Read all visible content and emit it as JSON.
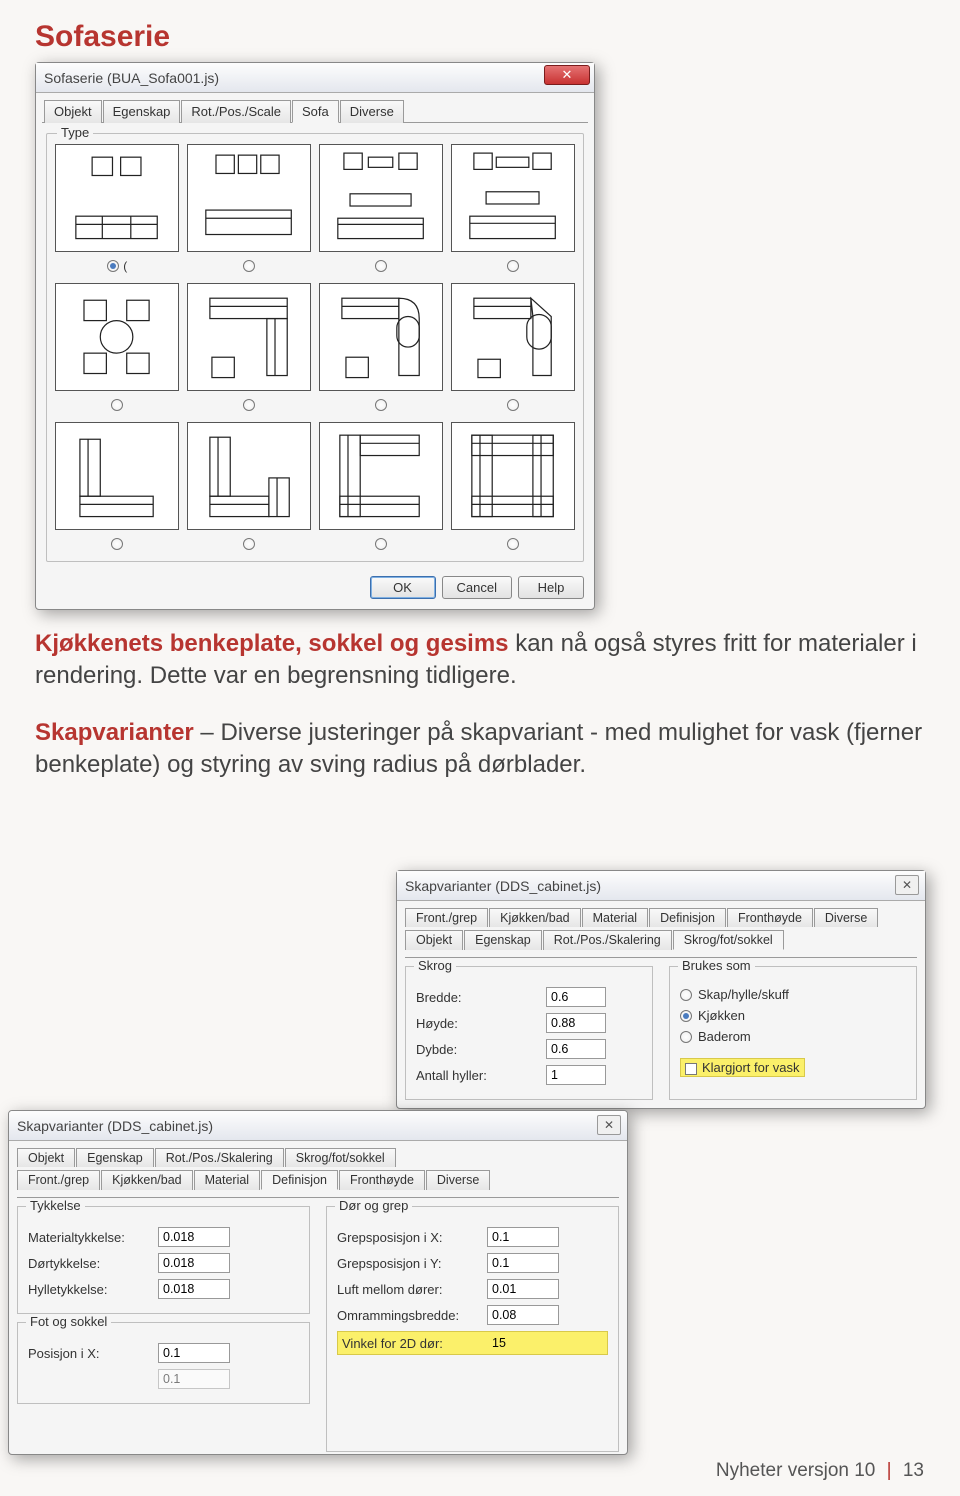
{
  "headings": {
    "sofaserie": "Sofaserie",
    "kjokken_prefix": "Kjøkkenets benkeplate, sokkel og gesims",
    "skapvar_prefix": "Skapvarianter"
  },
  "paragraphs": {
    "p1_rest": " kan nå også styres fritt for materialer i rendering. Dette var en begrensning tidligere.",
    "p2_rest": " – Diverse justeringer på skapvariant - med mulighet for vask (fjerner benkeplate) og styring av sving radius på dørblader."
  },
  "sofadialog": {
    "title": "Sofaserie (BUA_Sofa001.js)",
    "tabs": [
      "Objekt",
      "Egenskap",
      "Rot./Pos./Scale",
      "Sofa",
      "Diverse"
    ],
    "active_tab": "Sofa",
    "group": "Type",
    "selected_index": 0,
    "selected_suffix": "(",
    "buttons": {
      "ok": "OK",
      "cancel": "Cancel",
      "help": "Help"
    }
  },
  "skap1": {
    "title": "Skapvarianter (DDS_cabinet.js)",
    "tabs_top": [
      "Front./grep",
      "Kjøkken/bad",
      "Material",
      "Definisjon",
      "Fronthøyde",
      "Diverse"
    ],
    "tabs_bot": [
      "Objekt",
      "Egenskap",
      "Rot./Pos./Skalering",
      "Skrog/fot/sokkel"
    ],
    "active_tab": "Skrog/fot/sokkel",
    "grp_skrog": "Skrog",
    "grp_brukes": "Brukes som",
    "fields": {
      "bredde": {
        "label": "Bredde:",
        "value": "0.6"
      },
      "hoyde": {
        "label": "Høyde:",
        "value": "0.88"
      },
      "dybde": {
        "label": "Dybde:",
        "value": "0.6"
      },
      "antall": {
        "label": "Antall hyller:",
        "value": "1"
      }
    },
    "radios": {
      "skap": "Skap/hylle/skuff",
      "kjokken": "Kjøkken",
      "baderom": "Baderom"
    },
    "hl_checkbox": "Klargjort for vask"
  },
  "skap2": {
    "title": "Skapvarianter (DDS_cabinet.js)",
    "tabs_top": [
      "Objekt",
      "Egenskap",
      "Rot./Pos./Skalering",
      "Skrog/fot/sokkel"
    ],
    "tabs_bot": [
      "Front./grep",
      "Kjøkken/bad",
      "Material",
      "Definisjon",
      "Fronthøyde",
      "Diverse"
    ],
    "active_tab": "Definisjon",
    "grp_tykkelse": "Tykkelse",
    "grp_dor": "Dør og grep",
    "grp_fot": "Fot og sokkel",
    "fields": {
      "mat": {
        "label": "Materialtykkelse:",
        "value": "0.018"
      },
      "dor": {
        "label": "Dørtykkelse:",
        "value": "0.018"
      },
      "hylle": {
        "label": "Hylletykkelse:",
        "value": "0.018"
      },
      "posx": {
        "label": "Posisjon i X:",
        "value": "0.1"
      },
      "posxb": {
        "label": "",
        "value": "0.1"
      },
      "gx": {
        "label": "Grepsposisjon i X:",
        "value": "0.1"
      },
      "gy": {
        "label": "Grepsposisjon i Y:",
        "value": "0.1"
      },
      "luft": {
        "label": "Luft mellom dører:",
        "value": "0.01"
      },
      "om": {
        "label": "Omrammingsbredde:",
        "value": "0.08"
      },
      "vinkel": {
        "label": "Vinkel for 2D dør:",
        "value": "15"
      }
    }
  },
  "footer": {
    "text": "Nyheter versjon 10",
    "page": "13"
  }
}
